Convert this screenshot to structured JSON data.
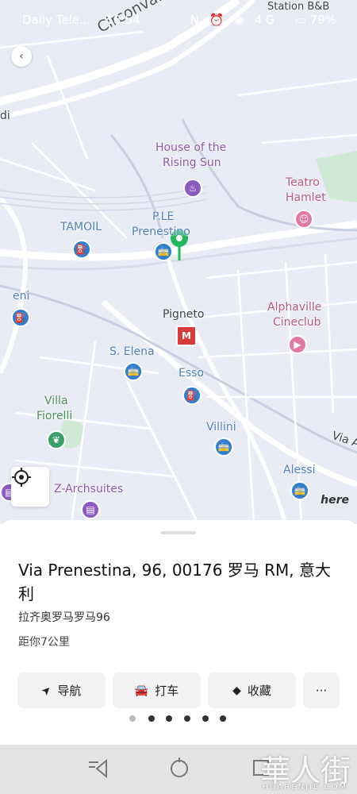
{
  "status_bar": {
    "carrier": "Daily Tele...",
    "time": "18:54",
    "icons": "N ⏰ ◉ 4G",
    "battery": "79%"
  },
  "map": {
    "labels": {
      "circonvallazione": "Circonvallazione",
      "station_bb": "Station B&B",
      "house_rising_sun": [
        "House of the",
        "Rising Sun"
      ],
      "teatro_hamlet": [
        "Teatro",
        "Hamlet"
      ],
      "tamoil": "TAMOIL",
      "ple_prenestino": [
        "P.LE",
        "Prenestino"
      ],
      "eni": "eni",
      "pigneto": "Pigneto",
      "alphaville": [
        "Alphaville",
        "Cineclub"
      ],
      "s_elena": "S. Elena",
      "esso": "Esso",
      "villa_fiorelli": [
        "Villa",
        "Fiorelli"
      ],
      "villini": "Villini",
      "via_a": "Via A",
      "z_archsuites": "Z-Archsuites",
      "alessi": "Alessi",
      "di": "di"
    },
    "metro_icon_text": "M",
    "here_logo": "here",
    "colors": {
      "map_bg": "#e9ecf5",
      "road": "#ffffff",
      "pin": "#1fb85a"
    }
  },
  "sheet": {
    "title": "Via Prenestina, 96, 00176 罗马 RM, 意大利",
    "subtitle": "拉齐奥罗马罗马96",
    "distance": "距你7公里",
    "actions": [
      {
        "icon": "navigation-arrow-icon",
        "glyph": "➤",
        "label": "导航"
      },
      {
        "icon": "car-icon",
        "glyph": "🚗",
        "label": "打车"
      },
      {
        "icon": "cube-icon",
        "glyph": "◆",
        "label": "收藏"
      },
      {
        "icon": "more-icon",
        "glyph": "···",
        "label": ""
      }
    ],
    "pager_count": 6,
    "pager_active": 0
  },
  "watermark": {
    "text": "華人街",
    "sub": "HUARENJIE.COM"
  }
}
